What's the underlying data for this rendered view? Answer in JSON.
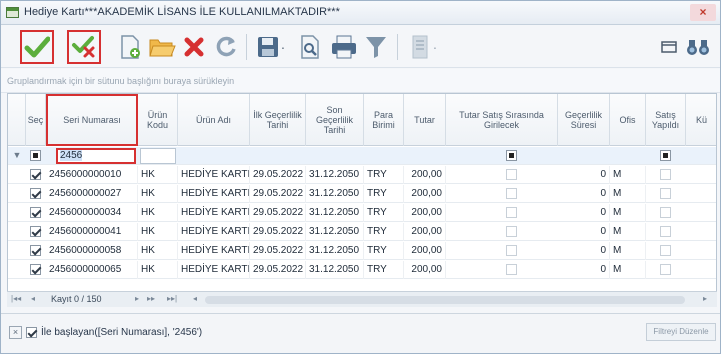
{
  "window": {
    "title": "Hediye Kartı***AKADEMİK LİSANS İLE KULLANILMAKTADIR***",
    "close_label": "×"
  },
  "toolbar": {
    "icons": [
      "check-icon",
      "check-cancel-icon",
      "new-document-icon",
      "open-folder-icon",
      "delete-icon",
      "refresh-icon",
      "save-icon",
      "preview-icon",
      "print-icon",
      "filter-icon",
      "layout-icon",
      "window-icon",
      "binoculars-icon"
    ],
    "dropdown_caret": "·"
  },
  "group_panel": {
    "hint": "Gruplandırmak için bir sütunu başlığını buraya sürükleyin"
  },
  "grid": {
    "columns": [
      "Seç",
      "Seri Numarası",
      "Ürün Kodu",
      "Ürün Adı",
      "İlk Geçerlilik Tarihi",
      "Son Geçerlilik Tarihi",
      "Para Birimi",
      "Tutar",
      "Tutar Satış Sırasında Girilecek",
      "Geçerlilik Süresi",
      "Ofis",
      "Satış Yapıldı",
      "Kü"
    ],
    "filter_row": {
      "indicator": "▼",
      "seri_value": "2456"
    },
    "rows": [
      {
        "seri": "2456000000010",
        "kod": "HK",
        "ad": "HEDİYE KARTI",
        "ilk": "29.05.2022",
        "son": "31.12.2050",
        "para": "TRY",
        "tutar": "200,00",
        "sure": "0",
        "ofis": "M"
      },
      {
        "seri": "2456000000027",
        "kod": "HK",
        "ad": "HEDİYE KARTI",
        "ilk": "29.05.2022",
        "son": "31.12.2050",
        "para": "TRY",
        "tutar": "200,00",
        "sure": "0",
        "ofis": "M"
      },
      {
        "seri": "2456000000034",
        "kod": "HK",
        "ad": "HEDİYE KARTI",
        "ilk": "29.05.2022",
        "son": "31.12.2050",
        "para": "TRY",
        "tutar": "200,00",
        "sure": "0",
        "ofis": "M"
      },
      {
        "seri": "2456000000041",
        "kod": "HK",
        "ad": "HEDİYE KARTI",
        "ilk": "29.05.2022",
        "son": "31.12.2050",
        "para": "TRY",
        "tutar": "200,00",
        "sure": "0",
        "ofis": "M"
      },
      {
        "seri": "2456000000058",
        "kod": "HK",
        "ad": "HEDİYE KARTI",
        "ilk": "29.05.2022",
        "son": "31.12.2050",
        "para": "TRY",
        "tutar": "200,00",
        "sure": "0",
        "ofis": "M"
      },
      {
        "seri": "2456000000065",
        "kod": "HK",
        "ad": "HEDİYE KARTI",
        "ilk": "29.05.2022",
        "son": "31.12.2050",
        "para": "TRY",
        "tutar": "200,00",
        "sure": "0",
        "ofis": "M"
      }
    ]
  },
  "navigator": {
    "first": "|◂◂",
    "prev": "◂",
    "record": "Kayıt 0 / 150",
    "next": "▸",
    "next_page": "▸▸",
    "last": "▸▸|",
    "scroll_left": "◂",
    "scroll_right": "▸"
  },
  "filter_panel": {
    "clear": "×",
    "expression": "İle başlayan([Seri Numarası], '2456')",
    "edit_button": "Filtreyi Düzenle"
  },
  "colors": {
    "accent_red": "#d63031",
    "check_green": "#5cae3c"
  }
}
